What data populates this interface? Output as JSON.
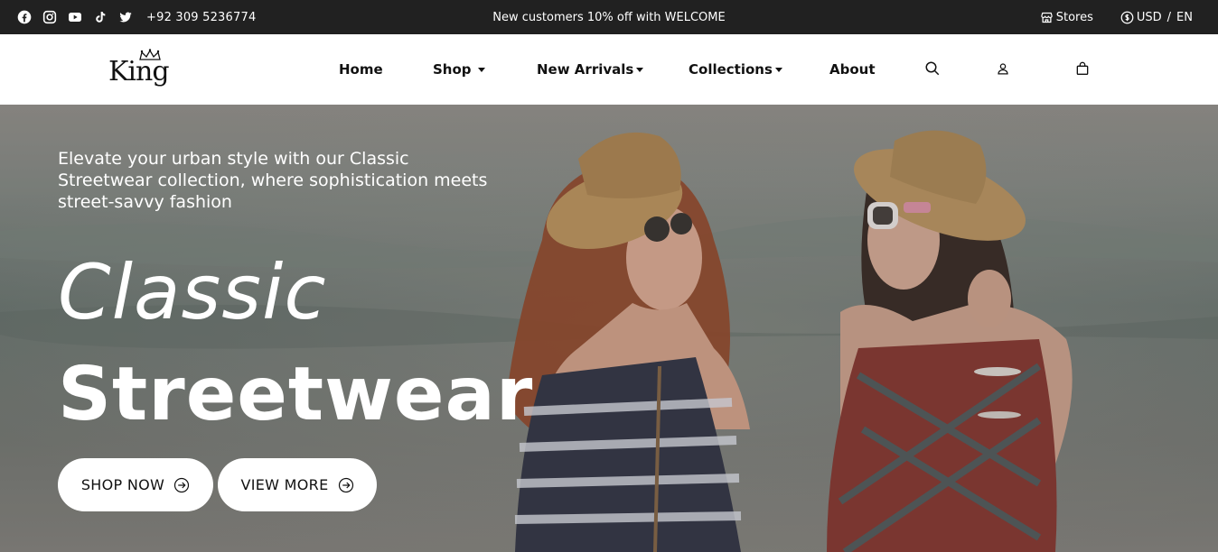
{
  "topbar": {
    "social_icons": [
      "facebook-icon",
      "instagram-icon",
      "youtube-icon",
      "tiktok-icon",
      "twitter-icon"
    ],
    "phone": "+92 309 5236774",
    "promo": "New customers 10% off with WELCOME",
    "stores_label": "Stores",
    "currency": "USD",
    "divider": "/",
    "language": "EN"
  },
  "nav": {
    "logo_text": "King",
    "items": [
      {
        "label": "Home",
        "dropdown": false
      },
      {
        "label": "Shop",
        "dropdown": true
      },
      {
        "label": "New Arrivals",
        "dropdown": true
      },
      {
        "label": "Collections",
        "dropdown": true
      },
      {
        "label": "About",
        "dropdown": false
      }
    ],
    "icons": [
      "search-icon",
      "user-icon",
      "bag-icon"
    ]
  },
  "hero": {
    "tagline": "Elevate your urban style with our Classic Streetwear collection, where sophistication meets street-savvy fashion",
    "title_line1": "Classic",
    "title_line2": "Streetwear",
    "buttons": [
      {
        "label": "SHOP NOW",
        "icon": "arrow-right-circle-icon"
      },
      {
        "label": "VIEW MORE",
        "icon": "arrow-right-circle-icon"
      }
    ]
  },
  "colors": {
    "topbar_bg": "#212121",
    "nav_bg": "#ffffff",
    "text_dark": "#111111",
    "hero_text": "#ffffff"
  }
}
